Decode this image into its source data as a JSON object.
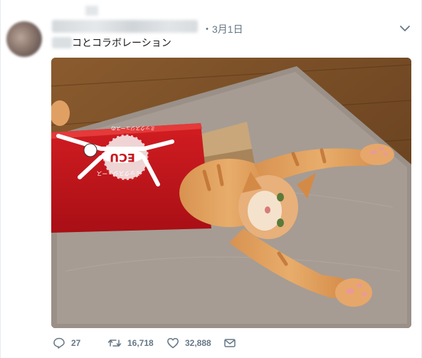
{
  "tweet": {
    "timestamp": "・3月1日",
    "text": "コとコラボレーション",
    "replies": "27",
    "retweets": "16,718",
    "likes": "32,888"
  },
  "box_print": {
    "top_line": "ミックスジュースの",
    "bottom_line": "ミックスジュース"
  },
  "colors": {
    "secondary_text": "#657786",
    "box_red": "#c8161d",
    "border": "#e6ecf0"
  },
  "icons": [
    "chevron-down-icon",
    "reply-icon",
    "retweet-icon",
    "like-icon",
    "direct-message-icon"
  ]
}
